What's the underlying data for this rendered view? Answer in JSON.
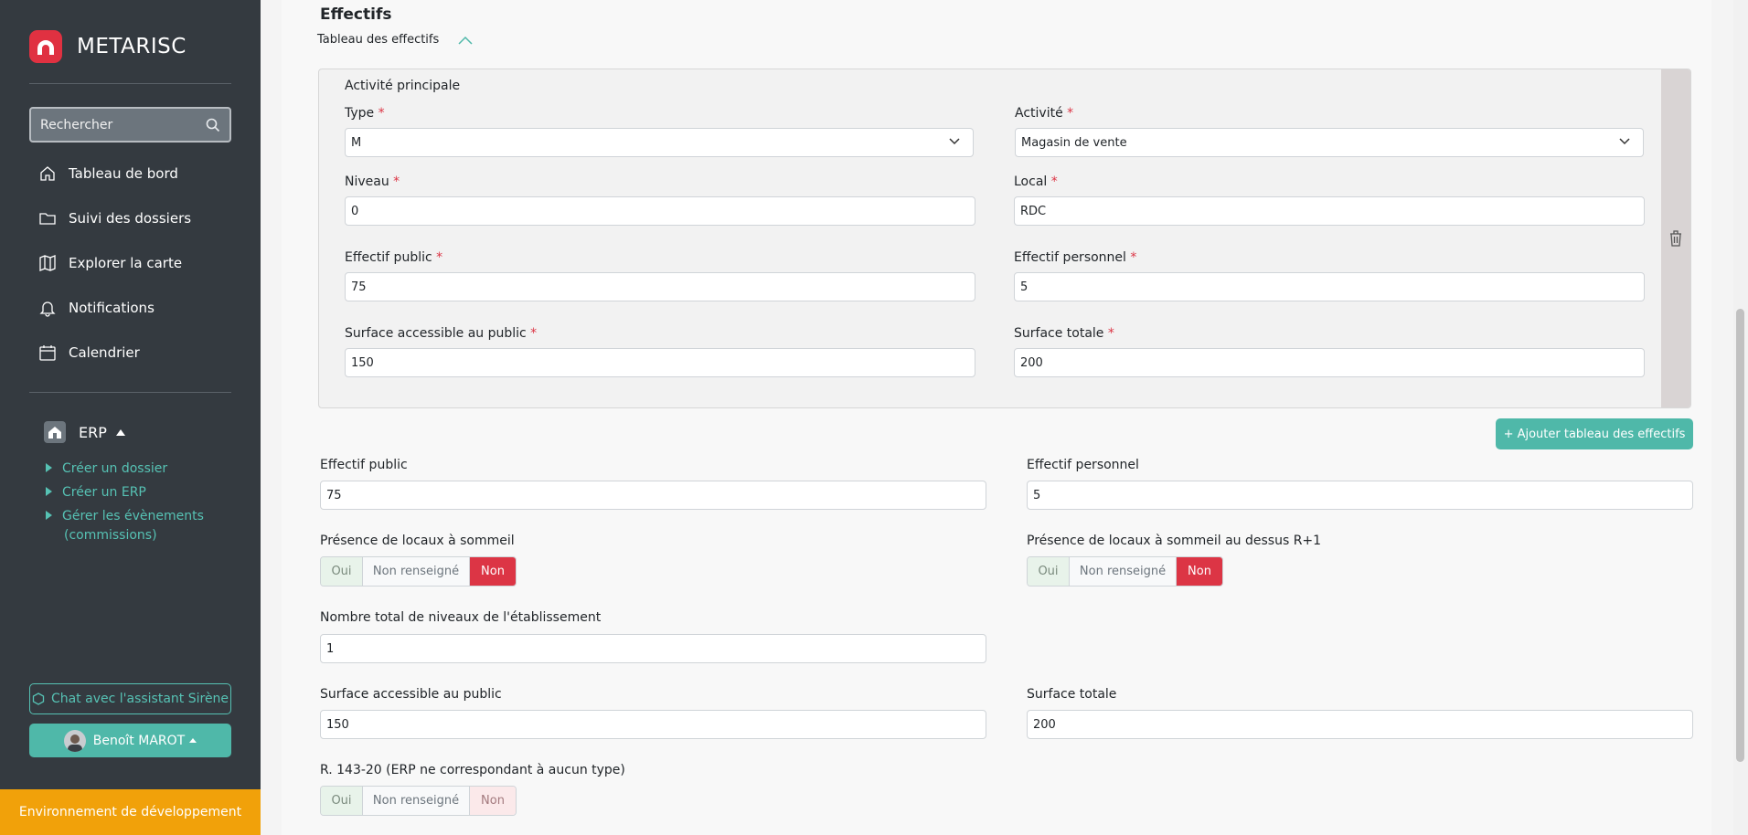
{
  "app": {
    "name": "METARISC"
  },
  "colors": {
    "brand": "#e03141",
    "accent": "#4fb8a9",
    "danger": "#dc3545",
    "env": "#f1a10a"
  },
  "sidebar": {
    "search_placeholder": "Rechercher",
    "nav": [
      {
        "label": "Tableau de bord",
        "icon": "home-icon"
      },
      {
        "label": "Suivi des dossiers",
        "icon": "folder-icon"
      },
      {
        "label": "Explorer la carte",
        "icon": "map-icon"
      },
      {
        "label": "Notifications",
        "icon": "bell-icon"
      },
      {
        "label": "Calendrier",
        "icon": "calendar-icon"
      }
    ],
    "erp": {
      "label": "ERP",
      "items": [
        "Créer un dossier",
        "Créer un ERP",
        "Gérer les évènements",
        "(commissions)"
      ]
    },
    "chat_label": "Chat avec l'assistant Sirène",
    "user_name": "Benoît MAROT",
    "env_label": "Environnement de développement"
  },
  "main": {
    "section_title": "Effectifs",
    "toggle_label": "Tableau des effectifs",
    "panel": {
      "title": "Activité principale",
      "type": {
        "label": "Type",
        "value": "M"
      },
      "activite": {
        "label": "Activité",
        "value": "Magasin de vente"
      },
      "niveau": {
        "label": "Niveau",
        "value": "0"
      },
      "local": {
        "label": "Local",
        "value": "RDC"
      },
      "effectif_public": {
        "label": "Effectif public",
        "value": "75"
      },
      "effectif_personnel": {
        "label": "Effectif personnel",
        "value": "5"
      },
      "surface_public": {
        "label": "Surface accessible au public",
        "value": "150"
      },
      "surface_totale": {
        "label": "Surface totale",
        "value": "200"
      },
      "required_mark": "*"
    },
    "add_button": "+ Ajouter tableau des effectifs",
    "summary": {
      "effectif_public": {
        "label": "Effectif public",
        "value": "75"
      },
      "effectif_personnel": {
        "label": "Effectif personnel",
        "value": "5"
      },
      "sommeil": {
        "label": "Présence de locaux à sommeil"
      },
      "sommeil_r1": {
        "label": "Présence de locaux à sommeil au dessus R+1"
      },
      "niveaux": {
        "label": "Nombre total de niveaux de l'établissement",
        "value": "1"
      },
      "surface_public": {
        "label": "Surface accessible au public",
        "value": "150"
      },
      "surface_totale": {
        "label": "Surface totale",
        "value": "200"
      },
      "r143": {
        "label": "R. 143-20 (ERP ne correspondant à aucun type)"
      }
    },
    "toggle_options": {
      "oui": "Oui",
      "nr": "Non renseigné",
      "non": "Non"
    }
  }
}
